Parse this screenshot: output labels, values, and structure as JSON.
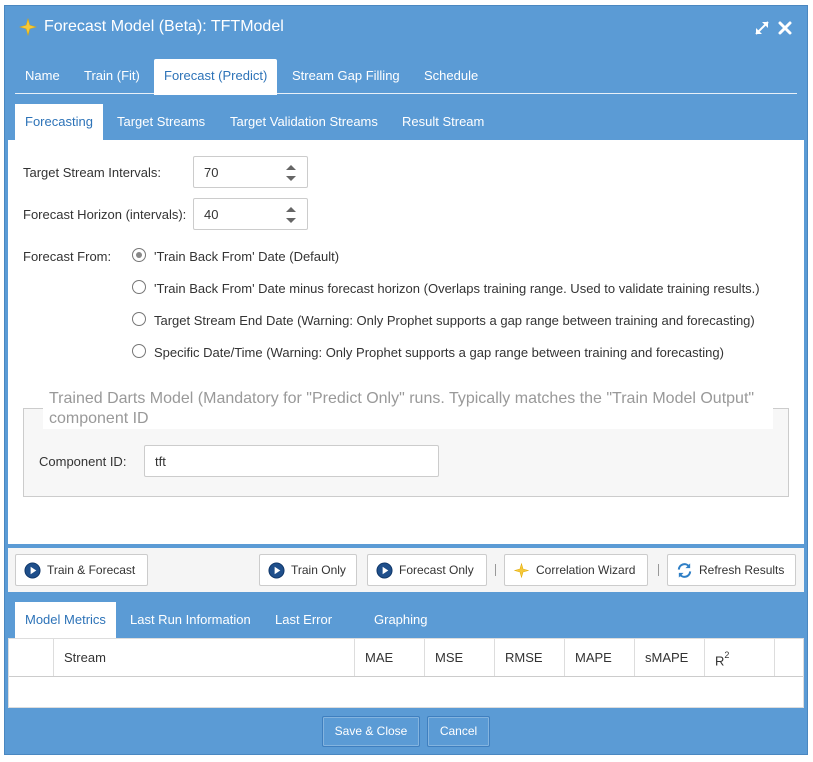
{
  "window": {
    "title": "Forecast Model (Beta): TFTModel",
    "colors": {
      "frame": "#5b9bd5",
      "active_tab_text": "#2d73b8"
    }
  },
  "main_tabs": [
    {
      "label": "Name"
    },
    {
      "label": "Train (Fit)"
    },
    {
      "label": "Forecast (Predict)",
      "active": true
    },
    {
      "label": "Stream Gap Filling"
    },
    {
      "label": "Schedule"
    }
  ],
  "sub_tabs": [
    {
      "label": "Forecasting",
      "active": true
    },
    {
      "label": "Target Streams"
    },
    {
      "label": "Target Validation Streams"
    },
    {
      "label": "Result Stream"
    }
  ],
  "form": {
    "target_intervals_label": "Target Stream Intervals:",
    "target_intervals_value": "70",
    "horizon_label": "Forecast Horizon (intervals):",
    "horizon_value": "40",
    "forecast_from_label": "Forecast From:",
    "forecast_from_options": [
      {
        "label": "'Train Back From' Date (Default)",
        "checked": true
      },
      {
        "label": "'Train Back From' Date minus forecast horizon (Overlaps training range. Used to validate training results.)"
      },
      {
        "label": "Target Stream End Date (Warning: Only Prophet supports a gap range between training and forecasting)"
      },
      {
        "label": "Specific Date/Time (Warning: Only Prophet supports a gap range between training and forecasting)"
      }
    ],
    "trained_model_legend": "Trained Darts Model (Mandatory for \"Predict Only\" runs. Typically matches the \"Train Model Output\" component ID",
    "component_id_label": "Component ID:",
    "component_id_value": "tft"
  },
  "toolbar": {
    "train_forecast": "Train & Forecast",
    "train_only": "Train Only",
    "forecast_only": "Forecast Only",
    "correlation_wizard": "Correlation Wizard",
    "refresh_results": "Refresh Results"
  },
  "result_tabs": [
    {
      "label": "Model Metrics",
      "active": true
    },
    {
      "label": "Last Run Information"
    },
    {
      "label": "Last Error"
    },
    {
      "label": "Graphing"
    }
  ],
  "metrics_table": {
    "columns": [
      "Stream",
      "MAE",
      "MSE",
      "RMSE",
      "MAPE",
      "sMAPE",
      "R",
      "2"
    ]
  },
  "footer": {
    "save_close": "Save & Close",
    "cancel": "Cancel"
  }
}
